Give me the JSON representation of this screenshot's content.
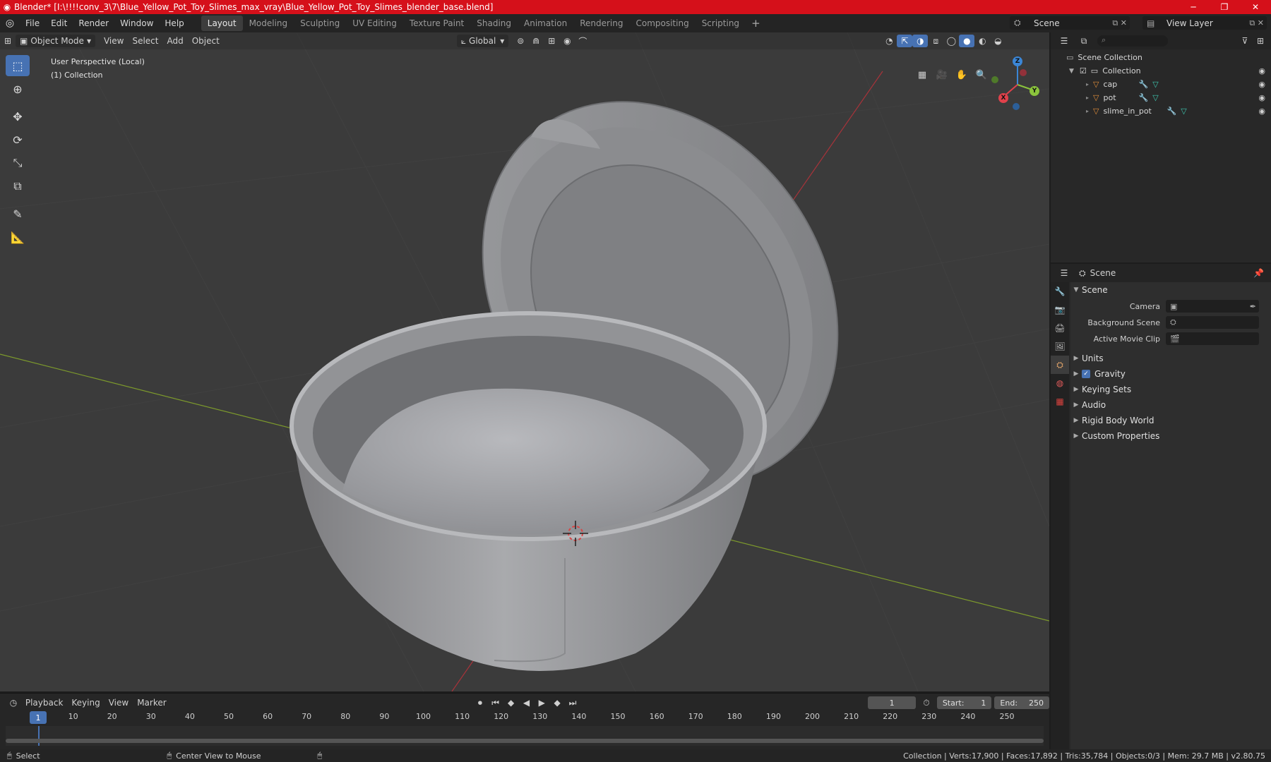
{
  "window": {
    "title": "Blender* [I:\\!!!!conv_3\\7\\Blue_Yellow_Pot_Toy_Slimes_max_vray\\Blue_Yellow_Pot_Toy_Slimes_blender_base.blend]",
    "minimize": "─",
    "maximize": "❐",
    "close": "✕"
  },
  "menubar": {
    "menus": [
      "File",
      "Edit",
      "Render",
      "Window",
      "Help"
    ],
    "workspaces": [
      "Layout",
      "Modeling",
      "Sculpting",
      "UV Editing",
      "Texture Paint",
      "Shading",
      "Animation",
      "Rendering",
      "Compositing",
      "Scripting"
    ],
    "add_tab": "+",
    "scene_name": "Scene",
    "view_layer": "View Layer"
  },
  "viewport": {
    "mode": "Object Mode",
    "menus": [
      "View",
      "Select",
      "Add",
      "Object"
    ],
    "transform_orientation": "Global",
    "perspective_label": "User Perspective (Local)",
    "collection_label": "(1) Collection",
    "gizmo_axes": {
      "x": "X",
      "y": "Y",
      "z": "Z"
    }
  },
  "outliner": {
    "root": "Scene Collection",
    "collection": "Collection",
    "objects": [
      {
        "name": "cap"
      },
      {
        "name": "pot"
      },
      {
        "name": "slime_in_pot"
      }
    ]
  },
  "properties": {
    "context": "Scene",
    "panel": "Scene",
    "fields": [
      {
        "label": "Camera",
        "value": ""
      },
      {
        "label": "Background Scene",
        "value": ""
      },
      {
        "label": "Active Movie Clip",
        "value": ""
      }
    ],
    "subpanels": [
      "Units",
      "Gravity",
      "Keying Sets",
      "Audio",
      "Rigid Body World",
      "Custom Properties"
    ],
    "gravity_enabled": true
  },
  "timeline": {
    "menus": [
      "Playback",
      "Keying",
      "View",
      "Marker"
    ],
    "current_frame": "1",
    "start_label": "Start:",
    "start": "1",
    "end_label": "End:",
    "end": "250",
    "ruler_frames": [
      "1",
      "10",
      "20",
      "30",
      "40",
      "50",
      "60",
      "70",
      "80",
      "90",
      "100",
      "110",
      "120",
      "130",
      "140",
      "150",
      "160",
      "170",
      "180",
      "190",
      "200",
      "210",
      "220",
      "230",
      "240",
      "250"
    ]
  },
  "statusbar": {
    "select": "Select",
    "center_view": "Center View to Mouse",
    "stats": "Collection | Verts:17,900 | Faces:17,892 | Tris:35,784 | Objects:0/3 | Mem: 29.7 MB | v2.80.75"
  },
  "colors": {
    "titlebar": "#d5101a",
    "accent": "#4772b3",
    "axis_x": "#e0414b",
    "axis_y": "#8bc43c",
    "axis_z": "#3b86d6"
  }
}
